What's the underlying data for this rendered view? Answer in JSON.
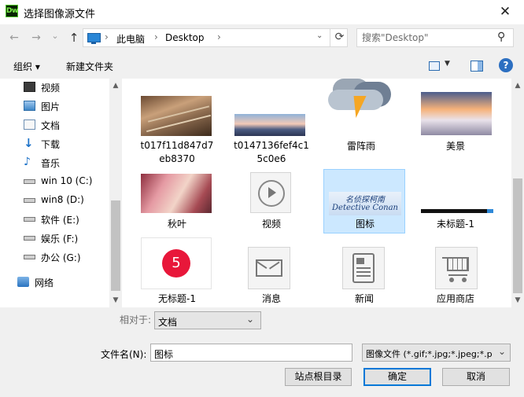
{
  "window": {
    "app_icon_text": "Dw",
    "title": "选择图像源文件",
    "close_glyph": "✕"
  },
  "address": {
    "back_glyph": "←",
    "forward_glyph": "→",
    "recent_glyph": "⌄",
    "up_glyph": "↑",
    "crumbs": [
      "此电脑",
      "Desktop"
    ],
    "sep_glyph": "›",
    "refresh_glyph": "⟳",
    "search_placeholder": "搜索\"Desktop\"",
    "search_glyph": "⚲"
  },
  "toolbar": {
    "organize_label": "组织 ▾",
    "new_folder_label": "新建文件夹",
    "help_glyph": "?"
  },
  "nav": {
    "items": [
      {
        "label": "视频",
        "icon": "video-icon"
      },
      {
        "label": "图片",
        "icon": "pictures-icon"
      },
      {
        "label": "文档",
        "icon": "documents-icon"
      },
      {
        "label": "下载",
        "icon": "download-icon"
      },
      {
        "label": "音乐",
        "icon": "music-icon"
      },
      {
        "label": "win 10 (C:)",
        "icon": "drive-icon"
      },
      {
        "label": "win8 (D:)",
        "icon": "drive-icon"
      },
      {
        "label": "软件 (E:)",
        "icon": "drive-icon"
      },
      {
        "label": "娱乐 (F:)",
        "icon": "drive-icon"
      },
      {
        "label": "办公 (G:)",
        "icon": "drive-icon"
      },
      {
        "label": "网络",
        "icon": "network-icon"
      }
    ]
  },
  "files": {
    "items": [
      {
        "caption": "t017f11d847d7eb8370",
        "line1": "t017f11d847d7",
        "line2": "eb8370"
      },
      {
        "caption": "t0147136fef4c15c0e6",
        "line1": "t0147136fef4c1",
        "line2": "5c0e6"
      },
      {
        "caption": "雷阵雨"
      },
      {
        "caption": "美景"
      },
      {
        "caption": "秋叶"
      },
      {
        "caption": "视频"
      },
      {
        "caption": "图标",
        "selected": true,
        "image_text_1": "名侦探柯南",
        "image_text_2": "Detective Conan"
      },
      {
        "caption": "未标题-1"
      },
      {
        "caption": "无标题-1",
        "badge": "5"
      },
      {
        "caption": "消息"
      },
      {
        "caption": "新闻"
      },
      {
        "caption": "应用商店"
      }
    ]
  },
  "bottom": {
    "relative_label": "相对于:",
    "relative_value": "文档",
    "filename_label": "文件名(N):",
    "filename_value": "图标",
    "filetype_value": "图像文件 (*.gif;*.jpg;*.jpeg;*.p",
    "site_root_button": "站点根目录",
    "ok_button": "确定",
    "cancel_button": "取消",
    "dropdown_glyph": "⌄"
  },
  "colors": {
    "selection_bg": "#cce8ff",
    "selection_border": "#99d1ff",
    "default_button_border": "#0078d7",
    "badge_red": "#e8173a"
  }
}
